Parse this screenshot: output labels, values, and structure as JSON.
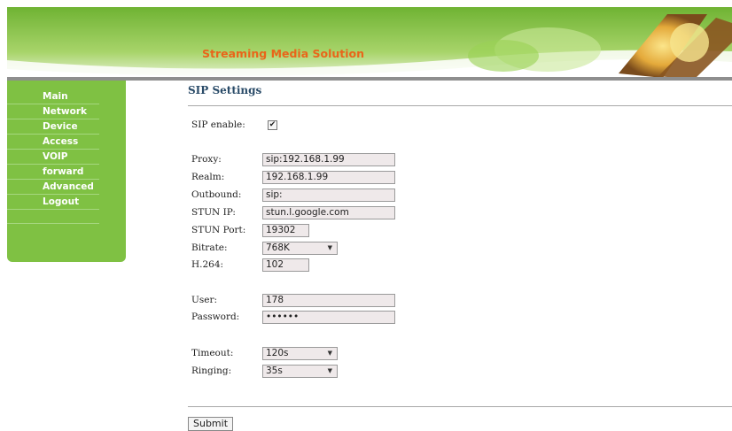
{
  "banner": {
    "title": "Streaming Media Solution"
  },
  "sidebar": {
    "items": [
      {
        "label": "Main"
      },
      {
        "label": "Network"
      },
      {
        "label": "Device"
      },
      {
        "label": "Access"
      },
      {
        "label": "VOIP"
      },
      {
        "label": "forward"
      },
      {
        "label": "Advanced"
      },
      {
        "label": "Logout"
      }
    ]
  },
  "page": {
    "title": "SIP Settings"
  },
  "form": {
    "sip_enable": {
      "label": "SIP enable:",
      "checked": true,
      "mark": "✔"
    },
    "proxy": {
      "label": "Proxy:",
      "value": "sip:192.168.1.99"
    },
    "realm": {
      "label": "Realm:",
      "value": "192.168.1.99"
    },
    "outbound": {
      "label": "Outbound:",
      "value": "sip:"
    },
    "stun_ip": {
      "label": "STUN IP:",
      "value": "stun.l.google.com"
    },
    "stun_port": {
      "label": "STUN Port:",
      "value": "19302"
    },
    "bitrate": {
      "label": "Bitrate:",
      "value": "768K"
    },
    "h264": {
      "label": "H.264:",
      "value": "102"
    },
    "user": {
      "label": "User:",
      "value": "178"
    },
    "password": {
      "label": "Password:",
      "value": "••••••"
    },
    "timeout": {
      "label": "Timeout:",
      "value": "120s"
    },
    "ringing": {
      "label": "Ringing:",
      "value": "35s"
    }
  },
  "submit": {
    "label": "Submit"
  },
  "colors": {
    "banner_green": "#7fc143",
    "sidebar_green": "#7fc143",
    "title_orange": "#e9651a",
    "heading_blue": "#2a4b68"
  }
}
